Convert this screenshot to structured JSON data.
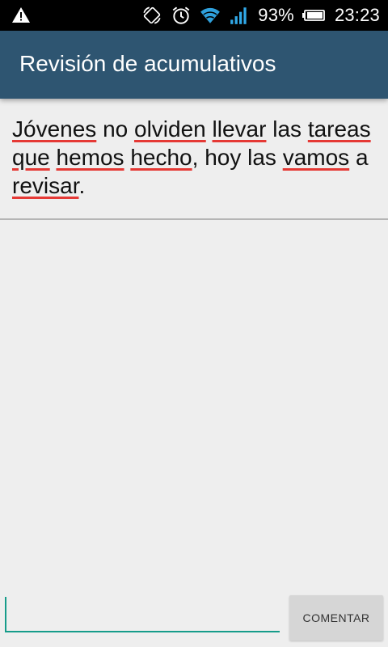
{
  "status_bar": {
    "battery_percent": "93%",
    "time": "23:23",
    "icons": [
      "warning-icon",
      "screen-rotate-icon",
      "alarm-icon",
      "wifi-icon",
      "signal-icon",
      "battery-icon"
    ]
  },
  "action_bar": {
    "title": "Revisión de acumulativos",
    "background": "#2e5571"
  },
  "message": {
    "words": [
      {
        "text": "Jóvenes",
        "misspelled": true
      },
      {
        "text": " ",
        "misspelled": false
      },
      {
        "text": "no",
        "misspelled": false
      },
      {
        "text": " ",
        "misspelled": false
      },
      {
        "text": "olviden",
        "misspelled": true
      },
      {
        "text": " ",
        "misspelled": false
      },
      {
        "text": "llevar",
        "misspelled": true
      },
      {
        "text": " ",
        "misspelled": false
      },
      {
        "text": "las",
        "misspelled": false
      },
      {
        "text": " ",
        "misspelled": false
      },
      {
        "text": "tareas",
        "misspelled": true
      },
      {
        "text": " ",
        "misspelled": false
      },
      {
        "text": "que",
        "misspelled": true
      },
      {
        "text": " ",
        "misspelled": false
      },
      {
        "text": "hemos",
        "misspelled": true
      },
      {
        "text": " ",
        "misspelled": false
      },
      {
        "text": "hecho",
        "misspelled": true
      },
      {
        "text": ", ",
        "misspelled": false
      },
      {
        "text": "hoy",
        "misspelled": false
      },
      {
        "text": " ",
        "misspelled": false
      },
      {
        "text": "las",
        "misspelled": false
      },
      {
        "text": " ",
        "misspelled": false
      },
      {
        "text": "vamos",
        "misspelled": true
      },
      {
        "text": " ",
        "misspelled": false
      },
      {
        "text": "a",
        "misspelled": false
      },
      {
        "text": " ",
        "misspelled": false
      },
      {
        "text": "revisar",
        "misspelled": true
      },
      {
        "text": ".",
        "misspelled": false
      }
    ]
  },
  "comment_box": {
    "input_value": "",
    "input_placeholder": "",
    "button_label": "COMENTAR",
    "accent": "#169c8a"
  }
}
